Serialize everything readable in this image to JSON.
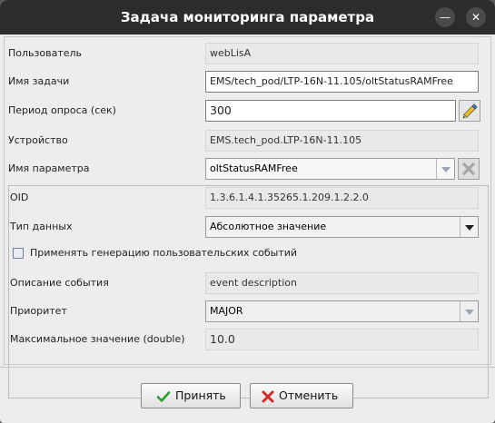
{
  "window": {
    "title": "Задача мониторинга параметра",
    "minimize_glyph": "—",
    "close_glyph": "✕"
  },
  "form": {
    "user_label": "Пользователь",
    "user_value": "webLisA",
    "task_name_label": "Имя задачи",
    "task_name_value": "EMS/tech_pod/LTP-16N-11.105/oltStatusRAMFree",
    "period_label": "Период опроса (сек)",
    "period_value": "300",
    "device_label": "Устройство",
    "device_value": "EMS.tech_pod.LTP-16N-11.105",
    "param_name_label": "Имя параметра",
    "param_name_value": "oltStatusRAMFree",
    "oid_label": "OID",
    "oid_value": "1.3.6.1.4.1.35265.1.209.1.2.2.0",
    "data_type_label": "Тип данных",
    "data_type_value": "Абсолютное значение",
    "custom_events_label": "Применять генерацию пользовательских событий",
    "custom_events_checked": false,
    "event_desc_label": "Описание события",
    "event_desc_value": "event description",
    "priority_label": "Приоритет",
    "priority_value": "MAJOR",
    "max_value_label": "Максимальное значение (double)",
    "max_value_value": "10.0"
  },
  "footer": {
    "accept_label": "Принять",
    "cancel_label": "Отменить"
  },
  "colors": {
    "titlebar": "#2c2c2c",
    "accept_icon": "#2e9e2e",
    "cancel_icon": "#d42a2a"
  },
  "icons": {
    "edit_period": "pencil-icon",
    "clear_param": "clear-x-icon",
    "accept": "checkmark-icon",
    "cancel": "red-x-icon"
  }
}
